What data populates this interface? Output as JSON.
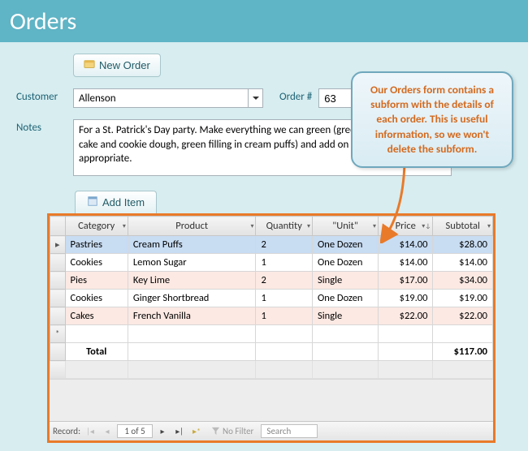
{
  "header": {
    "title": "Orders"
  },
  "buttons": {
    "new_order": "New Order",
    "add_item": "Add Item"
  },
  "labels": {
    "customer": "Customer",
    "order_num": "Order #",
    "notes": "Notes"
  },
  "fields": {
    "customer": "Allenson",
    "order_num": "63",
    "notes": "For a St. Patrick's Day party. Make everything we can green (green food coloring to cake and cookie dough, green filling in cream puffs) and add on green sprinkles where appropriate."
  },
  "grid": {
    "columns": [
      "Category",
      "Product",
      "Quantity",
      "\"Unit\"",
      "Price",
      "Subtotal"
    ],
    "rows": [
      {
        "category": "Pastries",
        "product": "Cream Puffs",
        "quantity": "2",
        "unit": "One Dozen",
        "price": "$14.00",
        "subtotal": "$28.00",
        "selected": true
      },
      {
        "category": "Cookies",
        "product": "Lemon Sugar",
        "quantity": "1",
        "unit": "One Dozen",
        "price": "$14.00",
        "subtotal": "$14.00"
      },
      {
        "category": "Pies",
        "product": "Key Lime",
        "quantity": "2",
        "unit": "Single",
        "price": "$17.00",
        "subtotal": "$34.00"
      },
      {
        "category": "Cookies",
        "product": "Ginger Shortbread",
        "quantity": "1",
        "unit": "One Dozen",
        "price": "$19.00",
        "subtotal": "$19.00"
      },
      {
        "category": "Cakes",
        "product": "French Vanilla",
        "quantity": "1",
        "unit": "Single",
        "price": "$22.00",
        "subtotal": "$22.00"
      }
    ],
    "total_label": "Total",
    "total_value": "$117.00"
  },
  "nav": {
    "record_label": "Record:",
    "position": "1 of 5",
    "filter": "No Filter",
    "search_placeholder": "Search"
  },
  "callout": {
    "text": "Our Orders form contains a subform with the details of each order. This is useful information, so we won't delete the subform."
  }
}
